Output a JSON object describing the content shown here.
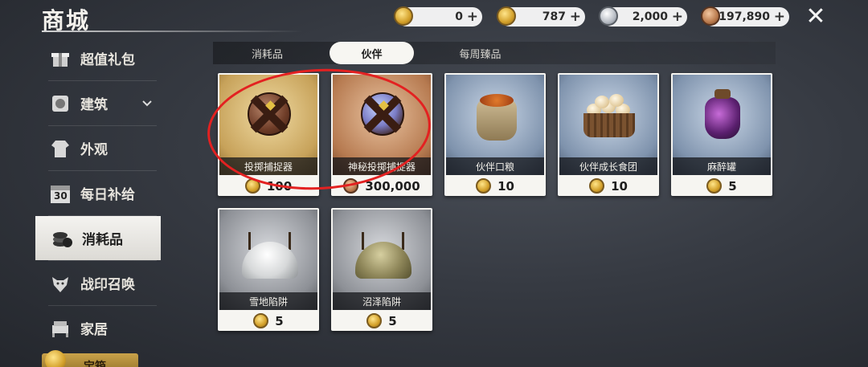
{
  "header": {
    "title": "商城",
    "close_icon": "close-icon"
  },
  "currencies": [
    {
      "value": "0",
      "icon": "gold-coin-icon",
      "color": "#d3a02a"
    },
    {
      "value": "787",
      "icon": "gold-coin-icon",
      "color": "#d3a02a"
    },
    {
      "value": "2,000",
      "icon": "silver-coin-icon",
      "color": "#b7bcc4"
    },
    {
      "value": "197,890",
      "icon": "bronze-coin-icon",
      "color": "#b97a4d"
    }
  ],
  "sidebar": {
    "items": [
      {
        "label": "超值礼包",
        "icon": "gift-pack-icon"
      },
      {
        "label": "建筑",
        "icon": "building-icon",
        "expandable": true
      },
      {
        "label": "外观",
        "icon": "outfit-icon"
      },
      {
        "label": "每日补给",
        "icon": "calendar-icon",
        "icon_text": "30"
      },
      {
        "label": "消耗品",
        "icon": "coins-stack-icon",
        "active": true
      },
      {
        "label": "战印召唤",
        "icon": "wolf-icon"
      },
      {
        "label": "家居",
        "icon": "furniture-icon"
      }
    ],
    "bottom_button_label": "宝箱"
  },
  "tabs": [
    {
      "label": "消耗品"
    },
    {
      "label": "伙伴",
      "active": true
    },
    {
      "label": "每周臻品"
    }
  ],
  "items": [
    {
      "name": "投掷捕捉器",
      "price": "100",
      "art": "gold",
      "kind": "ball"
    },
    {
      "name": "神秘投掷捕捉器",
      "price": "300,000",
      "art": "copper",
      "kind": "ball-blue"
    },
    {
      "name": "伙伴口粮",
      "price": "10",
      "art": "blue",
      "kind": "sack"
    },
    {
      "name": "伙伴成长食团",
      "price": "10",
      "art": "blue",
      "kind": "basket"
    },
    {
      "name": "麻醉罐",
      "price": "5",
      "art": "blue",
      "kind": "jar"
    },
    {
      "name": "雪地陷阱",
      "price": "5",
      "art": "grey",
      "kind": "trap-snow"
    },
    {
      "name": "沼泽陷阱",
      "price": "5",
      "art": "grey",
      "kind": "trap-swamp"
    }
  ],
  "colors": {
    "annotation": "#e32121",
    "card_bg": "#f6f5f1",
    "active_tab": "#f7f6f2"
  }
}
